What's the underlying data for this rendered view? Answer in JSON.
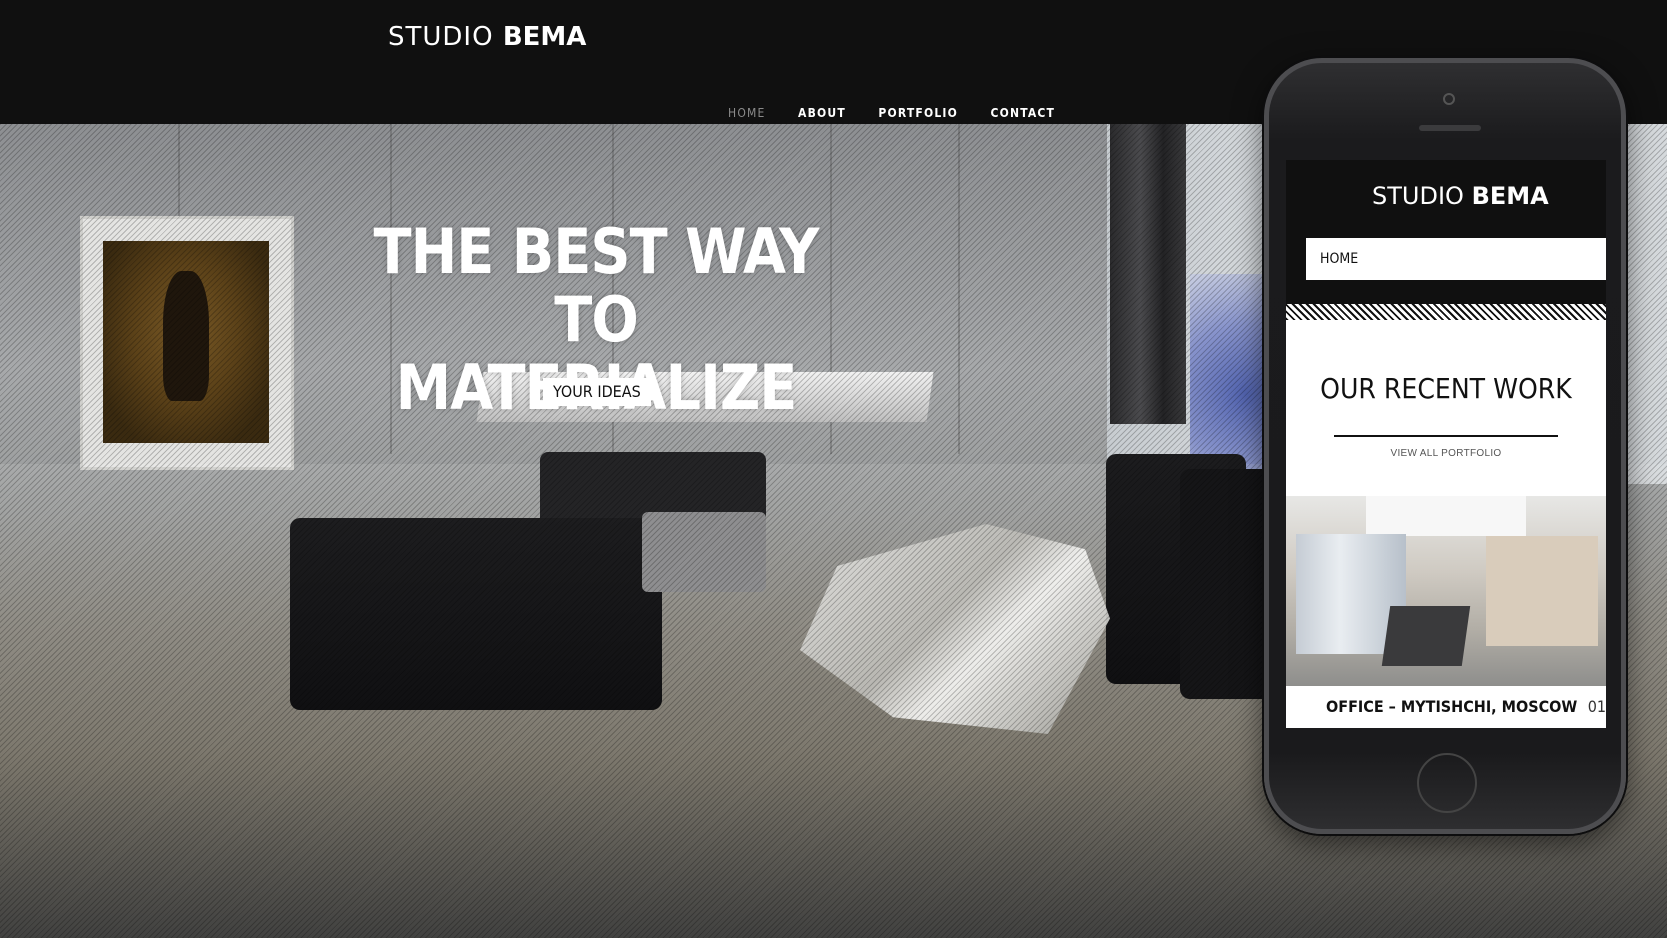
{
  "brand": {
    "word1": "STUDIO",
    "word2": "BEMA"
  },
  "nav": {
    "items": [
      {
        "label": "HOME",
        "active": true
      },
      {
        "label": "ABOUT",
        "active": false
      },
      {
        "label": "PORTFOLIO",
        "active": false
      },
      {
        "label": "CONTACT",
        "active": false
      }
    ]
  },
  "hero": {
    "line1": "THE BEST WAY",
    "line2": "TO MATERIALIZE",
    "badge": "YOUR IDEAS"
  },
  "mobile": {
    "brand": {
      "word1": "STUDIO",
      "word2": "BEMA"
    },
    "menu_selected": "HOME",
    "section_title": "OUR RECENT WORK",
    "section_link": "VIEW ALL PORTFOLIO",
    "project": {
      "title": "OFFICE – MYTISHCHI, MOSCOW",
      "number": "01"
    }
  },
  "colors": {
    "header_bg": "#101010",
    "nav_active": "#8a8a8a",
    "text_light": "#ffffff",
    "phone_body": "#1b1b1d"
  },
  "icons": [
    "phone-camera-icon",
    "phone-speaker-icon",
    "phone-home-button-icon"
  ]
}
